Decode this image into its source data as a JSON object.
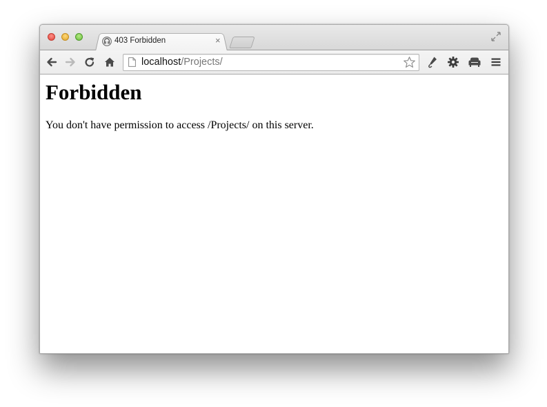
{
  "tab": {
    "title": "403 Forbidden",
    "close_glyph": "×",
    "favicon": "server-icon"
  },
  "toolbar": {
    "back_icon": "back-arrow-icon",
    "forward_icon": "forward-arrow-icon",
    "reload_icon": "reload-icon",
    "home_icon": "home-icon",
    "extension_icons": [
      "pen-extension-icon",
      "gear-icon",
      "sofa-extension-icon",
      "menu-icon"
    ]
  },
  "address_bar": {
    "host": "localhost",
    "path": "/Projects/",
    "bookmark_icon": "star-icon"
  },
  "page": {
    "heading": "Forbidden",
    "message": "You don't have permission to access /Projects/ on this server."
  },
  "colors": {
    "close": "#e0443b",
    "minimize": "#e0a72a",
    "zoom": "#6cbd3d"
  }
}
